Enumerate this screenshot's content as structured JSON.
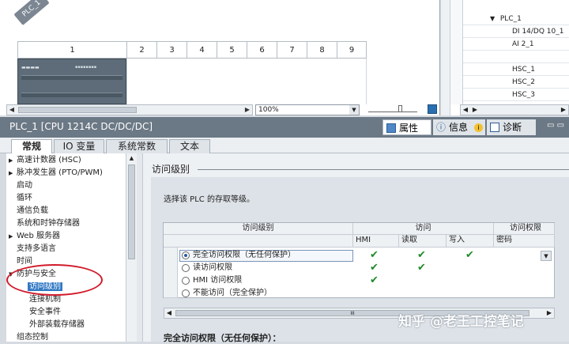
{
  "device_view": {
    "plc_tag": "PLC_1",
    "slots": [
      "1",
      "2",
      "3",
      "4",
      "5",
      "6",
      "7",
      "8",
      "9"
    ],
    "zoom": "100%"
  },
  "overview": {
    "rows": [
      "PLC_1",
      "DI 14/DQ 10_1",
      "AI 2_1",
      "",
      "HSC_1",
      "HSC_2",
      "HSC_3"
    ]
  },
  "inspector": {
    "title": "PLC_1 [CPU 1214C DC/DC/DC]",
    "tabs": {
      "properties": "属性",
      "info": "信息",
      "diagnostics": "诊断"
    },
    "subtabs": [
      "常规",
      "IO 变量",
      "系统常数",
      "文本"
    ]
  },
  "tree": {
    "items": [
      {
        "label": "高速计数器 (HSC)",
        "indent": 0,
        "expand": "▶"
      },
      {
        "label": "脉冲发生器 (PTO/PWM)",
        "indent": 0,
        "expand": "▶"
      },
      {
        "label": "启动",
        "indent": 0,
        "expand": ""
      },
      {
        "label": "循环",
        "indent": 0,
        "expand": ""
      },
      {
        "label": "通信负载",
        "indent": 0,
        "expand": ""
      },
      {
        "label": "系统和时钟存储器",
        "indent": 0,
        "expand": ""
      },
      {
        "label": "Web 服务器",
        "indent": 0,
        "expand": "▶"
      },
      {
        "label": "支持多语言",
        "indent": 0,
        "expand": ""
      },
      {
        "label": "时间",
        "indent": 0,
        "expand": ""
      },
      {
        "label": "防护与安全",
        "indent": 0,
        "expand": "▼"
      },
      {
        "label": "访问级别",
        "indent": 1,
        "expand": "",
        "selected": true
      },
      {
        "label": "连接机制",
        "indent": 1,
        "expand": ""
      },
      {
        "label": "安全事件",
        "indent": 1,
        "expand": ""
      },
      {
        "label": "外部装载存储器",
        "indent": 1,
        "expand": ""
      },
      {
        "label": "组态控制",
        "indent": 0,
        "expand": ""
      }
    ]
  },
  "content": {
    "section_title": "访问级别",
    "description": "选择该 PLC 的存取等级。",
    "table": {
      "col_level": "访问级别",
      "col_access": "访问",
      "col_permission": "访问权限",
      "sub_hmi": "HMI",
      "sub_read": "读取",
      "sub_write": "写入",
      "sub_password": "密码",
      "rows": [
        {
          "label": "完全访问权限（无任何保护）",
          "selected": true,
          "hmi": "✔",
          "read": "✔",
          "write": "✔"
        },
        {
          "label": "读访问权限",
          "selected": false,
          "hmi": "✔",
          "read": "✔",
          "write": ""
        },
        {
          "label": "HMI 访问权限",
          "selected": false,
          "hmi": "✔",
          "read": "",
          "write": ""
        },
        {
          "label": "不能访问（完全保护）",
          "selected": false,
          "hmi": "",
          "read": "",
          "write": ""
        }
      ],
      "scroll_thumb": "III"
    },
    "bottom_title": "完全访问权限（无任何保护）："
  },
  "watermark": "知乎 @老王工控笔记",
  "colors": {
    "selection": "#3279c4",
    "highlight_oval": "#d11a2a",
    "check": "#1f8a2a",
    "header_bar": "#6b7885"
  }
}
